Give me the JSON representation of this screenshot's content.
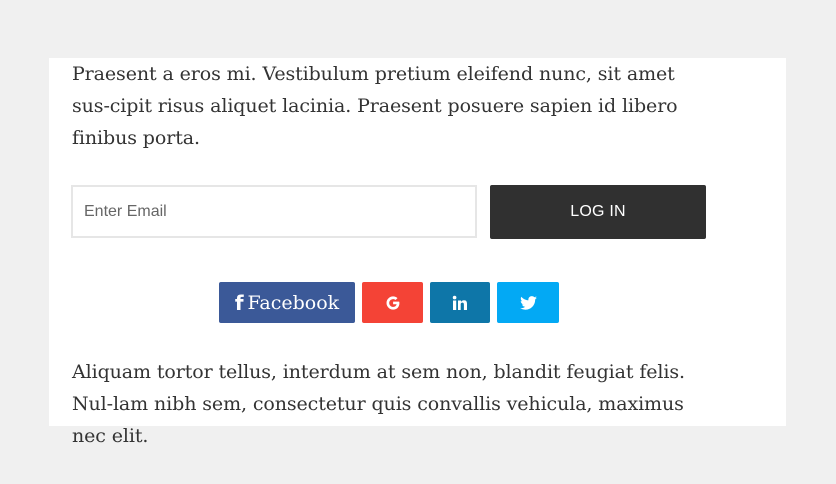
{
  "content": {
    "paragraph_top": "Praesent a eros mi. Vestibulum pretium eleifend nunc, sit amet sus-cipit risus aliquet lacinia. Praesent posuere sapien id libero finibus porta.",
    "paragraph_bottom": "Aliquam tortor tellus, interdum at sem non, blandit feugiat felis. Nul-lam nibh sem, consectetur quis convallis vehicula, maximus nec elit."
  },
  "login_form": {
    "email_placeholder": "Enter Email",
    "email_value": "",
    "login_label": "LOG IN"
  },
  "social": {
    "facebook_label": "Facebook",
    "facebook_icon": "facebook-icon",
    "google_icon": "google-icon",
    "linkedin_icon": "linkedin-icon",
    "twitter_icon": "twitter-icon"
  },
  "colors": {
    "page_background": "#f0f0f0",
    "card_background": "#ffffff",
    "text": "#333333",
    "login_button": "#303030",
    "facebook": "#3b5998",
    "google": "#f44336",
    "linkedin": "#0e76a8",
    "twitter": "#03a9f4"
  }
}
